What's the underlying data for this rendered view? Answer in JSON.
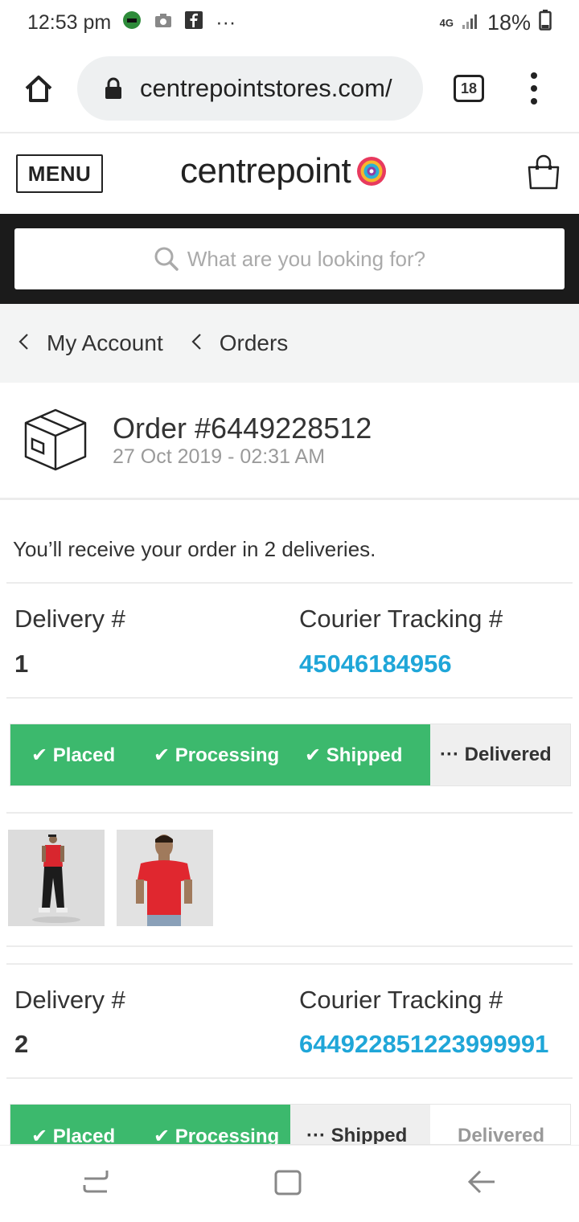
{
  "status_bar": {
    "time": "12:53 pm",
    "overflow": "···",
    "network": "4G",
    "battery": "18%"
  },
  "browser": {
    "url": "centrepointstores.com/",
    "tab_count": "18"
  },
  "site": {
    "menu_label": "MENU",
    "logo_text": "centrepoint"
  },
  "search": {
    "placeholder": "What are you looking for?"
  },
  "breadcrumb": [
    {
      "label": "My Account"
    },
    {
      "label": "Orders"
    }
  ],
  "order": {
    "title": "Order #6449228512",
    "date": "27 Oct 2019 - 02:31 AM",
    "deliveries_message": "You’ll receive your order in 2 deliveries."
  },
  "deliveries": [
    {
      "delivery_label": "Delivery #",
      "delivery_number": "1",
      "tracking_label": "Courier Tracking #",
      "tracking_number": "45046184956",
      "steps": [
        {
          "label": "✔ Placed",
          "status": "done"
        },
        {
          "label": "✔ Processing",
          "status": "done"
        },
        {
          "label": "✔ Shipped",
          "status": "done"
        },
        {
          "label": "··· Delivered",
          "status": "current"
        }
      ]
    },
    {
      "delivery_label": "Delivery #",
      "delivery_number": "2",
      "tracking_label": "Courier Tracking #",
      "tracking_number": "644922851223999991",
      "steps": [
        {
          "label": "✔ Placed",
          "status": "done"
        },
        {
          "label": "✔ Processing",
          "status": "done"
        },
        {
          "label": "··· Shipped",
          "status": "current"
        },
        {
          "label": "Delivered",
          "status": "pending"
        }
      ]
    }
  ],
  "colors": {
    "accent_green": "#3cb96d",
    "tracking_blue": "#1fa6d8",
    "search_band": "#1b1b1b"
  }
}
